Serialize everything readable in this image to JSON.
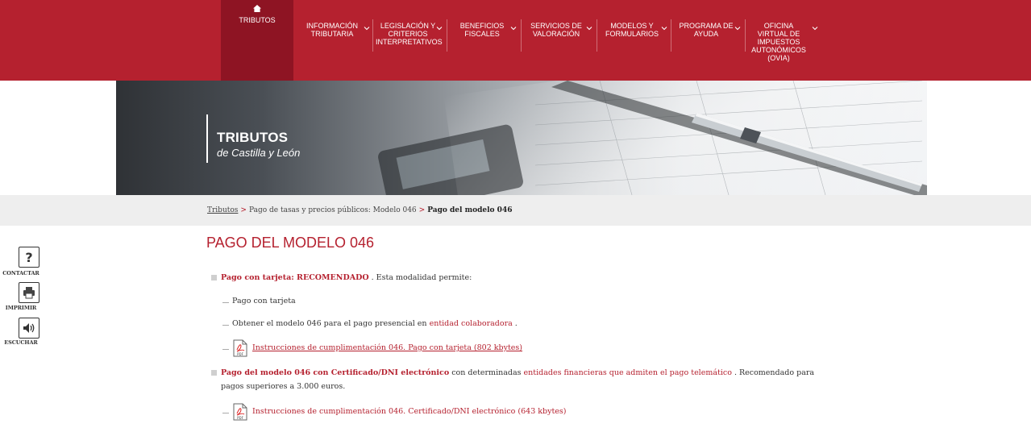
{
  "nav": {
    "items": [
      {
        "label": "TRIBUTOS"
      },
      {
        "label": "INFORMACIÓN\nTRIBUTARIA"
      },
      {
        "label": "LEGISLACIÓN Y\nCRITERIOS\nINTERPRETATIVOS"
      },
      {
        "label": "BENEFICIOS\nFISCALES"
      },
      {
        "label": "SERVICIOS DE\nVALORACIÓN"
      },
      {
        "label": "MODELOS Y\nFORMULARIOS"
      },
      {
        "label": "PROGRAMA DE\nAYUDA"
      },
      {
        "label": "OFICINA\nVIRTUAL DE\nIMPUESTOS\nAUTONÓMICOS\n(OVIA)"
      }
    ]
  },
  "banner": {
    "title": "TRIBUTOS",
    "subtitle": "de Castilla y León"
  },
  "breadcrumb": {
    "home": "Tributos",
    "sep1": ">",
    "middle": "Pago de tasas y precios públicos: Modelo 046",
    "sep2": ">",
    "current": "Pago del modelo 046"
  },
  "tools": {
    "contact": "CONTACTAR",
    "print": "IMPRIMIR",
    "listen": "ESCUCHAR"
  },
  "content": {
    "title": "PAGO DEL MODELO 046",
    "card": {
      "strong": "Pago con tarjeta: RECOMENDADO",
      "rest": " . Esta modalidad permite:",
      "sub1": "Pago con tarjeta",
      "sub2_pre": "Obtener el modelo 046 para el pago presencial en ",
      "sub2_link": "entidad colaboradora",
      "sub2_post": " .",
      "doc": "Instrucciones de cumplimentación 046. Pago con tarjeta (802 kbytes)"
    },
    "cert": {
      "strong": "Pago del modelo 046 con Certificado/DNI electrónico",
      "mid": " con determinadas ",
      "link": "entidades financieras que admiten el pago telemático",
      "post": " . Recomendado para",
      "line2": "pagos superiores a 3.000 euros.",
      "doc": "Instrucciones de cumplimentación 046. Certificado/DNI electrónico (643 kbytes)"
    },
    "pdf_label": "PDF"
  },
  "colors": {
    "brand": "#b5212f",
    "brand_dark": "#8e1423",
    "breadcrumb_bg": "#eeeeee"
  }
}
